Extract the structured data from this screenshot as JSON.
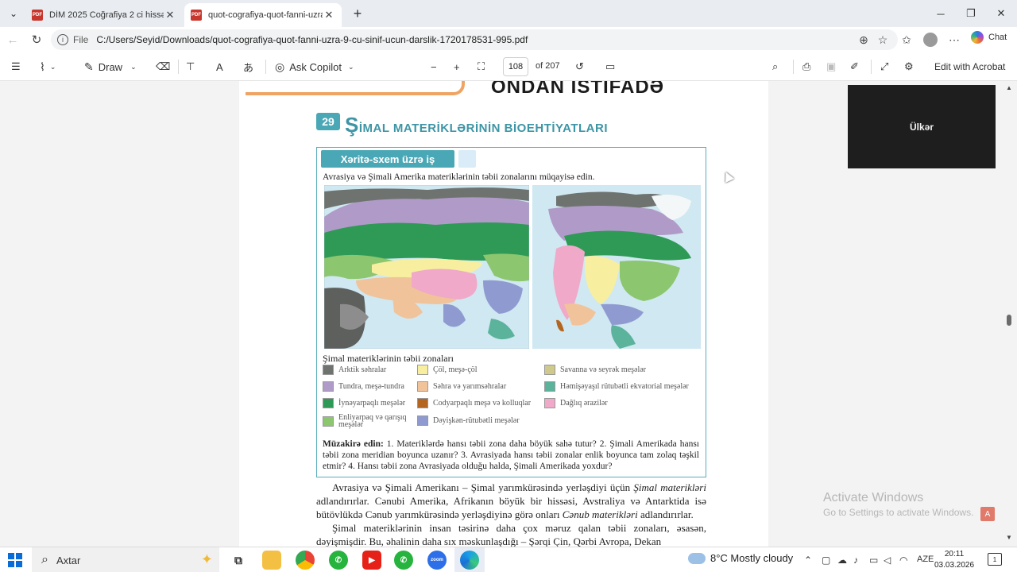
{
  "tabs": [
    {
      "title": "DİM 2025 Coğrafiya 2 ci hissə testl",
      "icon": "PDF"
    },
    {
      "title": "quot-cografiya-quot-fanni-uzra-9",
      "icon": "PDF"
    }
  ],
  "address": {
    "file_label": "File",
    "url": "C:/Users/Seyid/Downloads/quot-cografiya-quot-fanni-uzra-9-cu-sinif-ucun-darslik-1720178531-995.pdf",
    "chat_label": "Chat"
  },
  "toolbar": {
    "draw_label": "Draw",
    "ask_copilot_label": "Ask Copilot",
    "page_number": "108",
    "page_of": "of 207",
    "edit_acrobat_label": "Edit with Acrobat"
  },
  "page": {
    "prev_heading": "ONDAN İSTİFADƏ",
    "lesson_number": "29",
    "lesson_title_first": "Ş",
    "lesson_title_rest": "İMAL MATERİKLƏRİNİN  BİOEHTİYATLARI",
    "map_tab_label": "Xəritə-sxem üzrə iş",
    "map_instruction": "Avrasiya və Şimali Amerika materiklərinin təbii zonalarını müqayisə edin.",
    "legend_title": "Şimal materiklərinin təbii zonaları",
    "legend": [
      {
        "label": "Arktik səhralar",
        "color": "#6e7370"
      },
      {
        "label": "Tundra, meşə-tundra",
        "color": "#b09bc8"
      },
      {
        "label": "İynəyarpaqlı meşələr",
        "color": "#2f9a56"
      },
      {
        "label": "Enliyarpaq və qarışıq meşələr",
        "color": "#8cc66f"
      },
      {
        "label": "Çöl, meşə-çöl",
        "color": "#f7eea0"
      },
      {
        "label": "Səhra və yarımsəhralar",
        "color": "#f1c39a"
      },
      {
        "label": "Codyarpaqlı meşə və kolluqlar",
        "color": "#b4651f"
      },
      {
        "label": "Dəyişkən-rütubətli meşələr",
        "color": "#8f9bd0"
      },
      {
        "label": "Savanna və seyrək meşələr",
        "color": "#cfc98c"
      },
      {
        "label": "Həmişəyaşıl rütubətli ekvatorial meşələr",
        "color": "#5bb39b"
      },
      {
        "label": "Dağlıq ərazilər",
        "color": "#f0a9c8"
      }
    ],
    "discuss_label": "Müzakirə edin:",
    "discuss_text": " 1. Materiklərdə hansı təbii zona daha böyük sahə tutur? 2. Şimali Amerikada hansı təbii zona meridian boyunca uzanır? 3. Avrasiyada hansı təbii zonalar enlik boyunca tam zolaq təşkil etmir? 4. Hansı təbii zona Avrasiyada olduğu halda, Şimali Amerikada yoxdur?",
    "body_p1_a": "Avrasiya və Şimali Amerikanı – Şimal yarımkürəsində yerləşdiyi üçün ",
    "body_p1_i1": "Şimal materikləri",
    "body_p1_b": " adlandırırlar. Cənubi Amerika, Afrikanın böyük bir hissəsi, Avstraliya və Antarktida isə bütövlükdə Cənub yarımkürəsində yerləşdiyinə görə onları ",
    "body_p1_i2": "Cənub materikləri",
    "body_p1_c": " adlandırırlar.",
    "body_p2": "Şimal materiklərinin insan təsirinə daha çox məruz qalan təbii zonaları, əsasən, dəyişmişdir. Bu, əhalinin daha sıx məskunlaşdığı – Şərqi Çin, Qərbi Avropa, Dekan"
  },
  "meeting_name": "Ülkər",
  "activate": {
    "title": "Activate Windows",
    "subtitle": "Go to Settings to activate Windows."
  },
  "taskbar": {
    "search_label": "Axtar",
    "weather": "8°C  Mostly cloudy",
    "lang": "AZE",
    "time": "20:11",
    "date": "03.03.2026"
  }
}
